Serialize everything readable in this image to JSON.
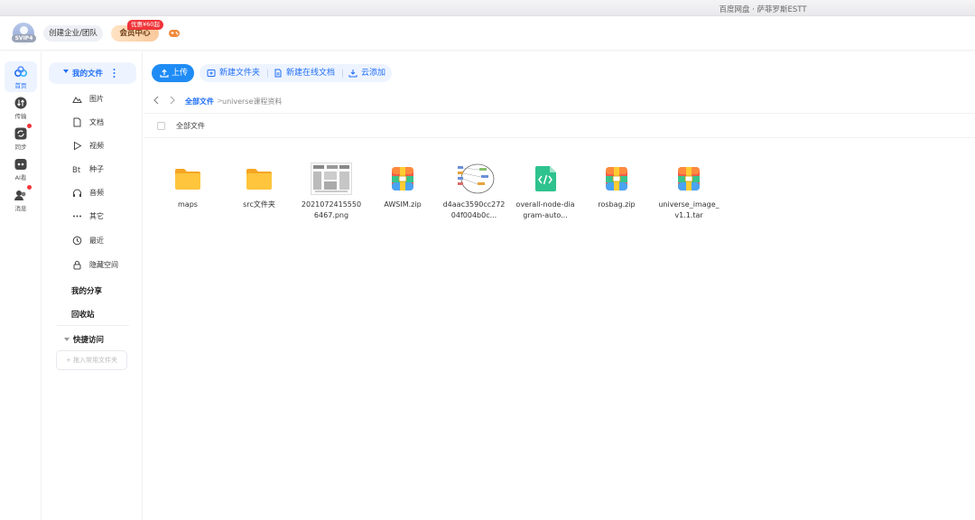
{
  "window": {
    "title": "百度网盘 · 萨菲罗斯ESTT"
  },
  "header": {
    "avatar_badge": "SVIP4",
    "team_button": "创建企业/团队",
    "vip_button": "会员中心",
    "promo_badge": "优惠¥60起"
  },
  "rail": {
    "items": [
      {
        "label": "首页",
        "icon": "cloud-icon",
        "active": true
      },
      {
        "label": "传输",
        "icon": "transfer-icon"
      },
      {
        "label": "同步",
        "icon": "sync-icon"
      },
      {
        "label": "AI看",
        "icon": "ai-icon"
      },
      {
        "label": "消息",
        "icon": "message-icon"
      }
    ]
  },
  "sidebar": {
    "my_files": "我的文件",
    "items": [
      {
        "label": "图片",
        "icon": "image-icon"
      },
      {
        "label": "文档",
        "icon": "document-icon"
      },
      {
        "label": "视频",
        "icon": "video-icon"
      },
      {
        "label": "种子",
        "icon": "bt-icon"
      },
      {
        "label": "音频",
        "icon": "audio-icon"
      },
      {
        "label": "其它",
        "icon": "more-icon"
      },
      {
        "label": "最近",
        "icon": "recent-icon"
      },
      {
        "label": "隐藏空间",
        "icon": "lock-icon"
      }
    ],
    "my_share": "我的分享",
    "recycle": "回收站",
    "quick_access": "快捷访问",
    "pin_button": "+ 拖入常用文件夹"
  },
  "toolbar": {
    "upload": "上传",
    "new_folder": "新建文件夹",
    "new_doc": "新建在线文档",
    "cloud_add": "云添加"
  },
  "breadcrumb": {
    "root": "全部文件",
    "separator": ">",
    "current": "universe课程资料"
  },
  "list_header": {
    "label": "全部文件"
  },
  "files": [
    {
      "name": "maps",
      "type": "folder"
    },
    {
      "name": "src文件夹",
      "type": "folder"
    },
    {
      "name": "20210724155506467.png",
      "type": "image"
    },
    {
      "name": "AWSIM.zip",
      "type": "zip"
    },
    {
      "name": "d4aac3590cc27204f004b0c...",
      "type": "diagram"
    },
    {
      "name": "overall-node-diagram-auto...",
      "type": "code"
    },
    {
      "name": "rosbag.zip",
      "type": "zip"
    },
    {
      "name": "universe_image_v1.1.tar",
      "type": "zip"
    }
  ],
  "colors": {
    "accent": "#1f6ef5",
    "upload": "#1f8cf5",
    "folder": "#ffc53d",
    "badge": "#f0353a"
  }
}
